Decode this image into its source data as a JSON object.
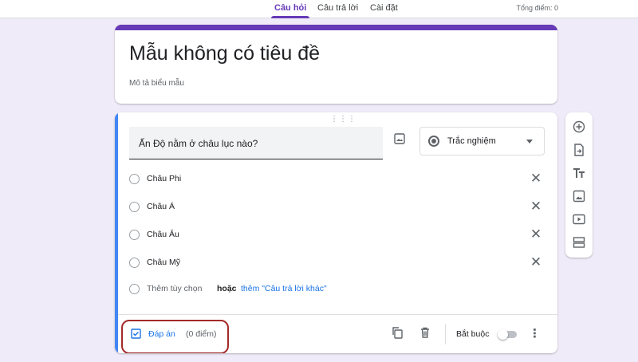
{
  "tabs": [
    {
      "label": "Câu hỏi",
      "active": true
    },
    {
      "label": "Câu trả lời",
      "active": false
    },
    {
      "label": "Cài đặt",
      "active": false
    }
  ],
  "total_points": "Tổng điểm: 0",
  "form": {
    "title": "Mẫu không có tiêu đề",
    "description_placeholder": "Mô tả biểu mẫu"
  },
  "question": {
    "text": "Ấn Độ nằm ở châu lục nào?",
    "type": "Trắc nghiệm",
    "options": [
      "Châu Phi",
      "Châu Á",
      "Châu Âu",
      "Châu Mỹ"
    ],
    "add_option": "Thêm tùy chọn",
    "or": "hoặc",
    "add_other": "thêm \"Câu trả lời khác\""
  },
  "footer": {
    "answer_key": "Đáp án",
    "points": "(0 điểm)",
    "required": "Bắt buộc",
    "required_on": false
  },
  "sidebar_tools": [
    "add-question-icon",
    "import-questions-icon",
    "add-title-icon",
    "add-image-icon",
    "add-video-icon",
    "add-section-icon"
  ],
  "colors": {
    "accent": "#673ab7",
    "background": "#f0ebf8",
    "active_card_bar": "#4285f4",
    "link": "#1a73e8",
    "highlight_box": "#a52a2a"
  }
}
